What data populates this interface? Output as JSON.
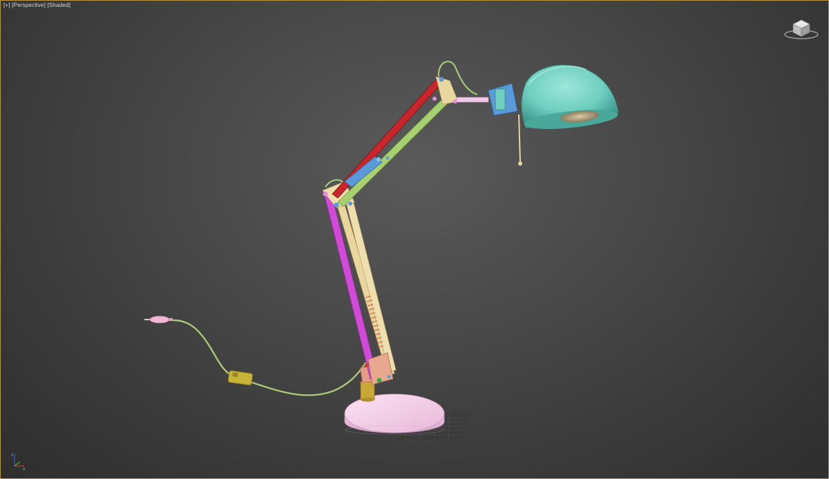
{
  "viewport": {
    "labels": {
      "plus": "[+]",
      "view": "[Perspective]",
      "shading": "[Shaded]"
    }
  },
  "viewcube": {
    "icon": "viewcube-icon"
  },
  "axis_gizmo": {
    "icon": "axis-gizmo-icon",
    "x_color": "#d83a3a",
    "y_color": "#3ad83a",
    "z_color": "#3a6ad8"
  },
  "model": {
    "object": "desk-lamp",
    "colors": {
      "shade": "#6fcfc0",
      "base": "#f2c6e4",
      "arm_red": "#c8262a",
      "arm_green": "#a8d070",
      "arm_magenta": "#d24ad8",
      "arm_yellow": "#ead7a0",
      "joint_blue": "#5a9ad8",
      "switch": "#c9b43a",
      "cable": "#a8c878",
      "spring": "#e06a4a"
    }
  }
}
